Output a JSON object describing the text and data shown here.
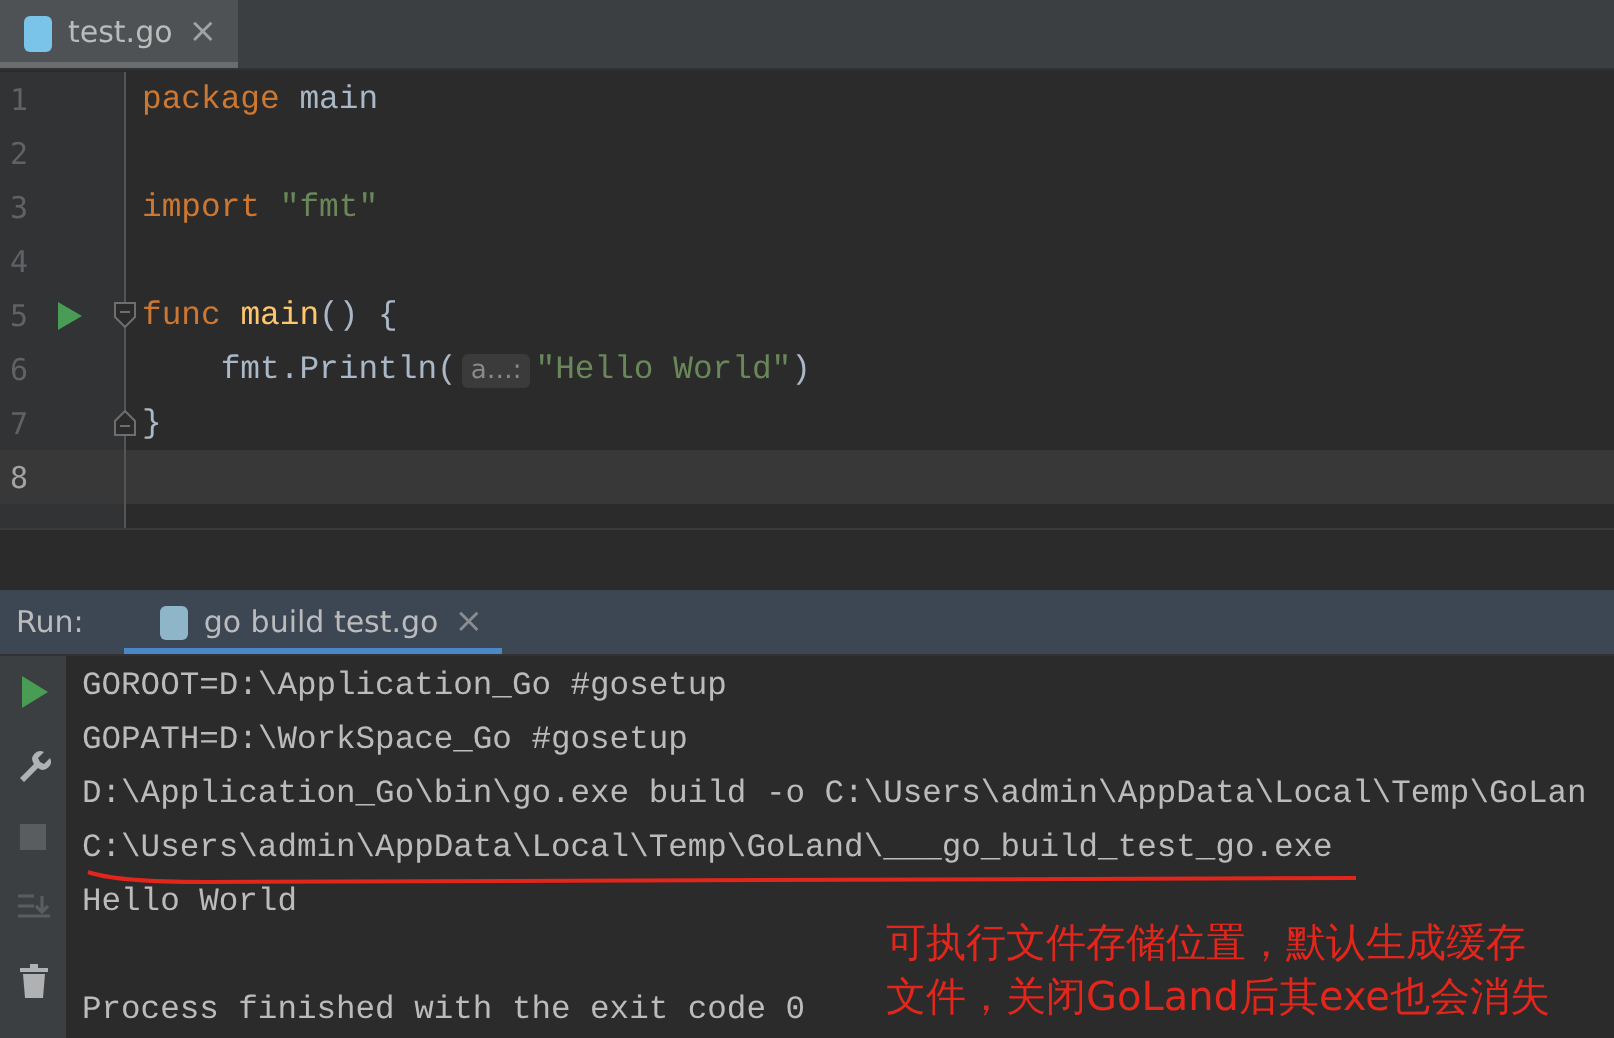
{
  "editor_tabs": [
    {
      "label": "test.go",
      "selected": true,
      "close": "×"
    }
  ],
  "code_lines": [
    {
      "number": "1",
      "current": false,
      "runnable": false,
      "fold_open": false,
      "fold_close": false,
      "tokens": [
        {
          "kind": "keyword",
          "text": "package"
        },
        {
          "kind": "plain",
          "text": " main"
        }
      ]
    },
    {
      "number": "2",
      "current": false,
      "runnable": false,
      "fold_open": false,
      "fold_close": false
    },
    {
      "number": "3",
      "current": false,
      "runnable": false,
      "fold_open": false,
      "fold_close": false,
      "tokens": [
        {
          "kind": "keyword",
          "text": "import"
        },
        {
          "kind": "string",
          "text": " \"fmt\""
        }
      ]
    },
    {
      "number": "4",
      "current": false,
      "runnable": false,
      "fold_open": false,
      "fold_close": false
    },
    {
      "number": "5",
      "current": false,
      "runnable": true,
      "fold_open": true,
      "fold_close": false,
      "tokens": [
        {
          "kind": "keyword",
          "text": "func"
        },
        {
          "kind": "function",
          "text": " main"
        },
        {
          "kind": "plain",
          "text": "() {"
        }
      ]
    },
    {
      "number": "6",
      "current": false,
      "runnable": false,
      "fold_open": false,
      "fold_close": false,
      "tokens": [
        {
          "kind": "plain",
          "text": "    fmt.Println("
        },
        {
          "kind": "hint",
          "text": "a…:"
        },
        {
          "kind": "string",
          "text": "\"Hello World\""
        },
        {
          "kind": "plain",
          "text": ")"
        }
      ]
    },
    {
      "number": "7",
      "current": false,
      "runnable": false,
      "fold_open": false,
      "fold_close": true,
      "tokens": [
        {
          "kind": "plain",
          "text": "}"
        }
      ]
    },
    {
      "number": "8",
      "current": true,
      "runnable": false,
      "fold_open": false,
      "fold_close": false
    }
  ],
  "run_panel": {
    "label": "Run:",
    "tabs": [
      {
        "label": "go build test.go",
        "selected": true,
        "close": "×"
      }
    ],
    "tools": [
      {
        "kind": "run",
        "disabled": false
      },
      {
        "kind": "wrench",
        "disabled": false
      },
      {
        "kind": "stop",
        "disabled": true
      },
      {
        "kind": "scroll",
        "disabled": true
      },
      {
        "kind": "trash",
        "disabled": false
      }
    ],
    "output": [
      {
        "text": "GOROOT=D:\\Application_Go #gosetup",
        "underlined": false
      },
      {
        "text": "GOPATH=D:\\WorkSpace_Go #gosetup",
        "underlined": false
      },
      {
        "text": "D:\\Application_Go\\bin\\go.exe build -o C:\\Users\\admin\\AppData\\Local\\Temp\\GoLan",
        "underlined": false
      },
      {
        "text": "C:\\Users\\admin\\AppData\\Local\\Temp\\GoLand\\___go_build_test_go.exe",
        "underlined": true
      },
      {
        "text": "Hello World",
        "underlined": false
      },
      {
        "underlined": false
      },
      {
        "text": "Process finished with the exit code 0",
        "underlined": false
      }
    ]
  },
  "annotation": {
    "text": "可执行文件存储位置，默认生成缓存文件，关闭GoLand后其exe也会消失"
  }
}
